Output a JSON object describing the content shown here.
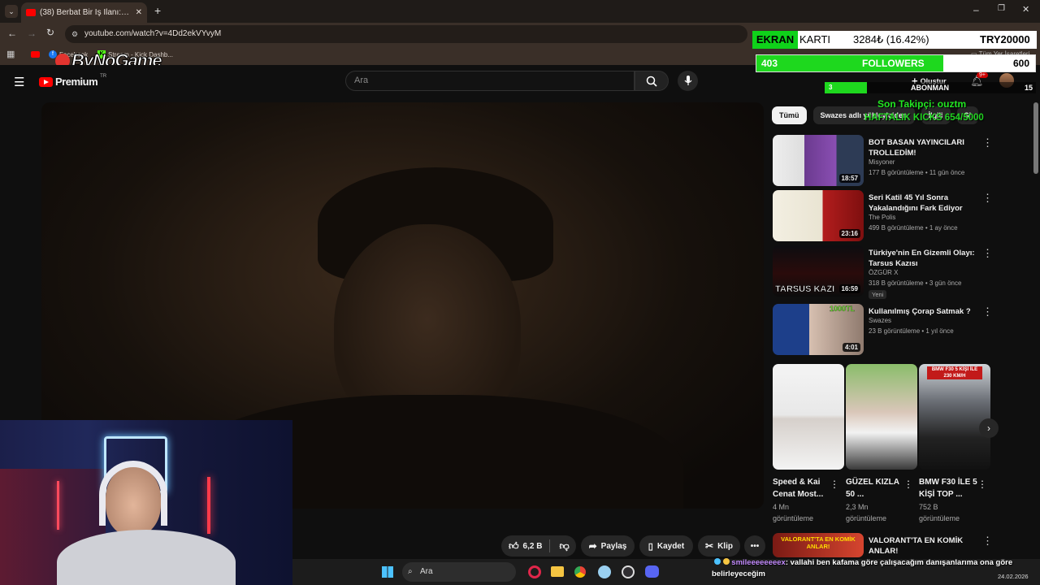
{
  "browser": {
    "tab_title": "(38) Berbat Bir İş İlanı: Oluşturd...",
    "url": "youtube.com/watch?v=4Dd2ekVYvyM",
    "bookmarks": [
      "Facebook",
      "Stream - Kick Dashb..."
    ],
    "bookmark_right": "Tüm Yer İşaretleri",
    "watermark": "ByNoGame"
  },
  "youtube": {
    "logo": "Premium",
    "logo_sup": "TR",
    "search_placeholder": "Ara",
    "create_label": "Oluştur",
    "notif_count": "9+"
  },
  "actions": {
    "likes": "6,2 B",
    "share": "Paylaş",
    "save": "Kaydet",
    "clip": "Klip"
  },
  "chips": [
    "Tümü",
    "Swazes adlı yükleyiciden",
    "İlgili",
    "Si"
  ],
  "recommendations": [
    {
      "title": "BOT BASAN YAYINCILARI TROLLEDİM!",
      "channel": "Misyoner",
      "meta": "177 B görüntüleme • 11 gün önce",
      "duration": "18:57",
      "badge": ""
    },
    {
      "title": "Seri Katil 45 Yıl Sonra Yakalandığını Fark Ediyor",
      "channel": "The Polis",
      "meta": "499 B görüntüleme • 1 ay önce",
      "duration": "23:16",
      "badge": ""
    },
    {
      "title": "Türkiye'nin En Gizemli Olayı: Tarsus Kazısı",
      "channel": "ÖZGÜR X",
      "meta": "318 B görüntüleme • 3 gün önce",
      "duration": "16:59",
      "badge": "Yeni",
      "thumb_text": "TARSUS KAZI"
    },
    {
      "title": "Kullanılmış Çorap Satmak ?",
      "channel": "Swazes",
      "meta": "23 B görüntüleme • 1 yıl önce",
      "duration": "4:01",
      "badge": "",
      "thumb_text": "1000TL"
    }
  ],
  "shorts": [
    {
      "title": "Speed & Kai Cenat Most...",
      "views": "4 Mn",
      "unit": "görüntüleme"
    },
    {
      "title": "GÜZEL KIZLA 50 ...",
      "views": "2,3 Mn",
      "unit": "görüntüleme"
    },
    {
      "title": "BMW F30 İLE 5 KİŞİ TOP ...",
      "views": "752 B",
      "unit": "görüntüleme",
      "thumb_text": "BMW F30 5 KİŞİ İLE 230 KM/H"
    }
  ],
  "next_rec": {
    "title": "VALORANT'TA EN KOMİK ANLAR!",
    "thumb_text": "VALORANT'TA EN KOMİK ANLAR!"
  },
  "overlay": {
    "ekran": "EKRAN",
    "karti": "KARTI",
    "price": "3284₺ (16.42%)",
    "goal": "TRY20000",
    "followers_count": "403",
    "followers_label": "FOLLOWERS",
    "followers_goal": "600",
    "followers_progress": 0.67,
    "sub_count": "3",
    "sub_label": "ABONMAN",
    "sub_goal": "15",
    "sub_progress": 0.2,
    "last_follower": "Son Takipçi: ouztm",
    "weekly_kicks": "HAFTALIK KICKS 654/5000"
  },
  "chat": {
    "user": "smileeeeeeeex",
    "message": ": vallahi ben kafama göre çalışacağım danışanlarıma ona göre belirleyeceğim"
  },
  "taskbar": {
    "search": "Ara",
    "date": "24.02.2026"
  }
}
